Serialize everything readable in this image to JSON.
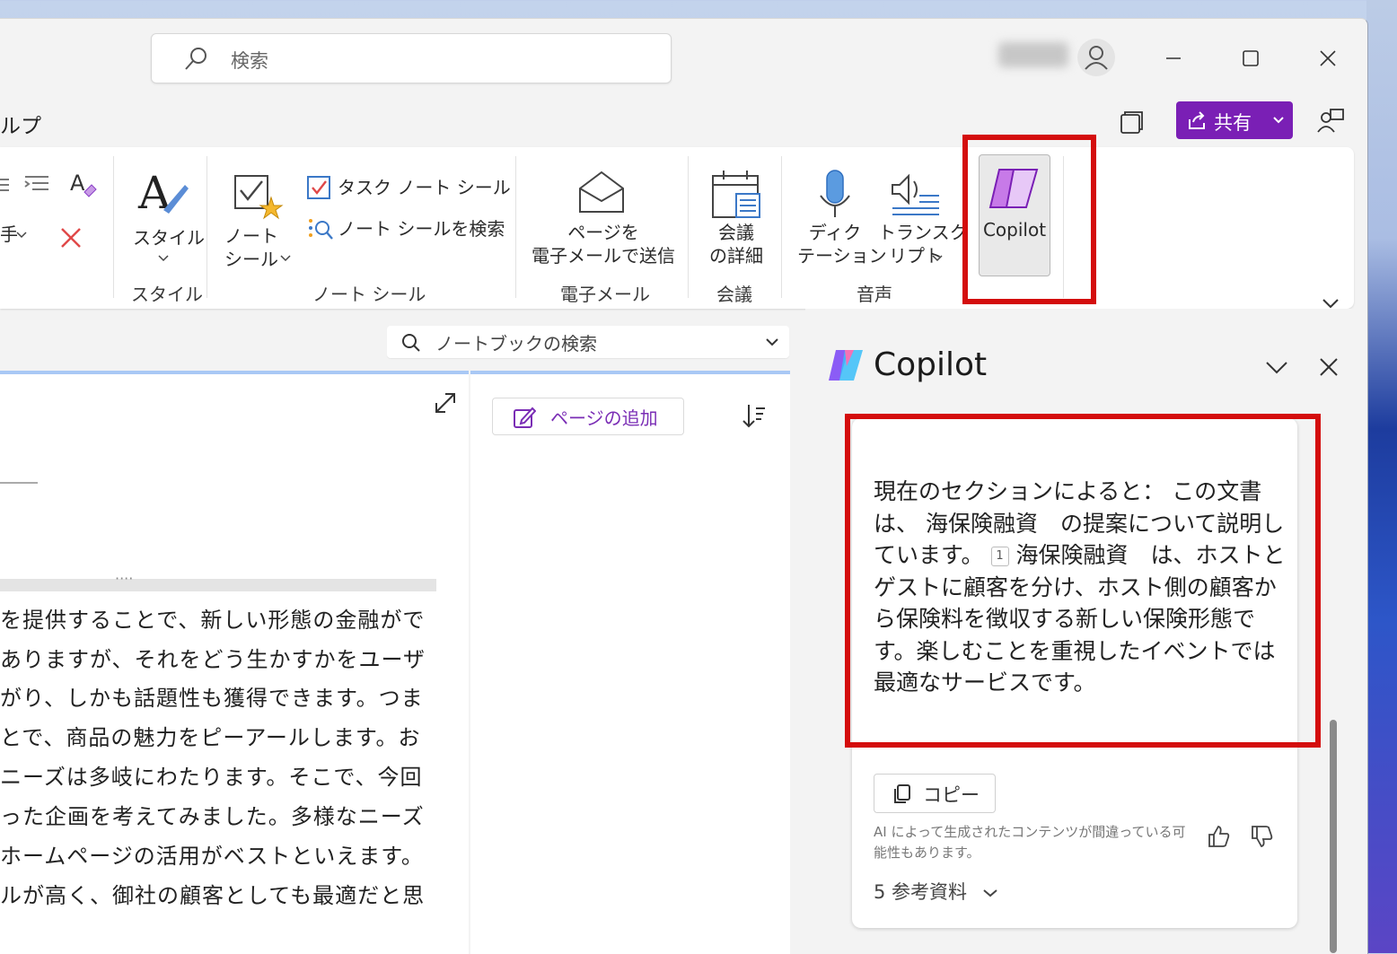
{
  "titlebar": {
    "search_placeholder": "検索"
  },
  "menu": {
    "partial_label": "ルプ"
  },
  "share": {
    "label": "共有"
  },
  "ribbon": {
    "style_group": {
      "button_label": "スタイル",
      "group_label": "スタイル"
    },
    "tags_group": {
      "note_tag_label": "ノート\nシール",
      "task_tag_label": "タスク ノート シール",
      "find_tags_label": "ノート シールを検索",
      "group_label": "ノート シール"
    },
    "email_group": {
      "button_label": "ページを\n電子メールで送信",
      "group_label": "電子メール"
    },
    "meeting_group": {
      "button_label": "会議\nの詳細",
      "group_label": "会議"
    },
    "voice_group": {
      "dictate_label": "ディク\nテーション",
      "transcribe_label": "トランスク\nリプト",
      "group_label": "音声"
    },
    "copilot_label": "Copilot",
    "partial_left_label": "手"
  },
  "notebook_search": {
    "placeholder": "ノートブックの検索"
  },
  "page_list": {
    "add_page_label": "ページの追加"
  },
  "page_content": {
    "lines": [
      "を提供することで、新しい形態の金融がで",
      "ありますが、それをどう生かすかをユーザ",
      "がり、しかも話題性も獲得できます。つま",
      "とで、商品の魅力をピーアールします。お",
      "ニーズは多岐にわたります。そこで、今回",
      "った企画を考えてみました。多様なニーズ",
      "ホームページの活用がベストといえます。",
      "ルが高く、御社の顧客としても最適だと思"
    ]
  },
  "copilot_pane": {
    "title": "Copilot",
    "response_part1": "現在のセクションによると： この文書は、 海保険融資　の提案について説明しています。",
    "citation": "1",
    "response_part2": "海保険融資　は、ホストとゲストに顧客を分け、ホスト側の顧客から保険料を徴収する新しい保険形態です。楽しむことを重視したイベントでは最適なサービスです。",
    "copy_label": "コピー",
    "disclaimer": "AI によって生成されたコンテンツが間違っている可能性もあります。",
    "references_label": "5 参考資料"
  },
  "colors": {
    "accent_purple": "#7a1fb5",
    "highlight_red": "#d40d0d"
  }
}
